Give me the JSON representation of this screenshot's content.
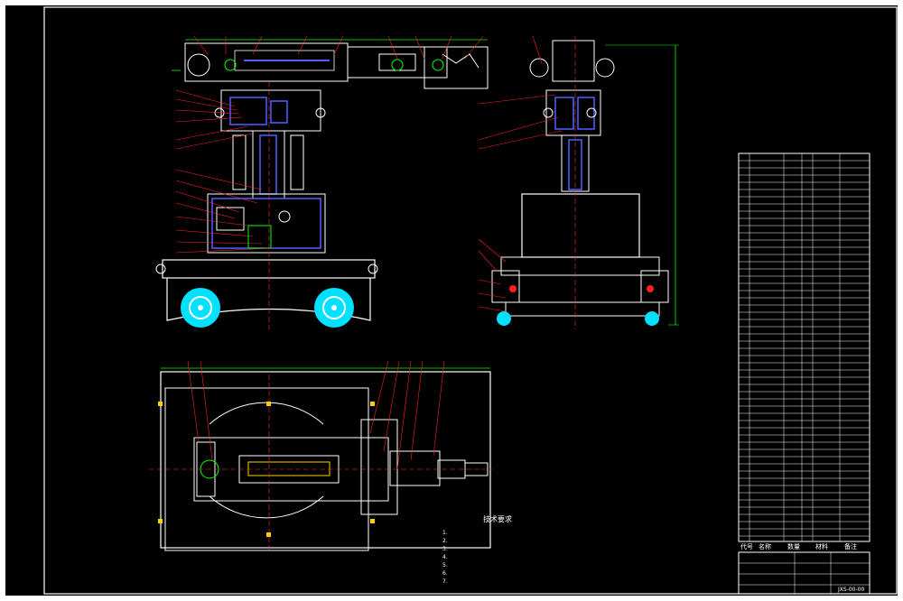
{
  "colors": {
    "background": "#000000",
    "outline": "#ffffff",
    "dimension": "#00ff00",
    "leader": "#ff2020",
    "centerline": "#ff3030",
    "hatch": "#5060ff",
    "wheel": "#00e0ff",
    "part": "#ffffff"
  },
  "drawing": {
    "notes_title": "技术要求",
    "notes": [
      "1.",
      "2.",
      "3.",
      "4.",
      "5.",
      "6.",
      "7."
    ],
    "bom_header": [
      "代号",
      "名称",
      "数量",
      "材料",
      "备注"
    ],
    "drawing_no": "JXS-00-00"
  }
}
